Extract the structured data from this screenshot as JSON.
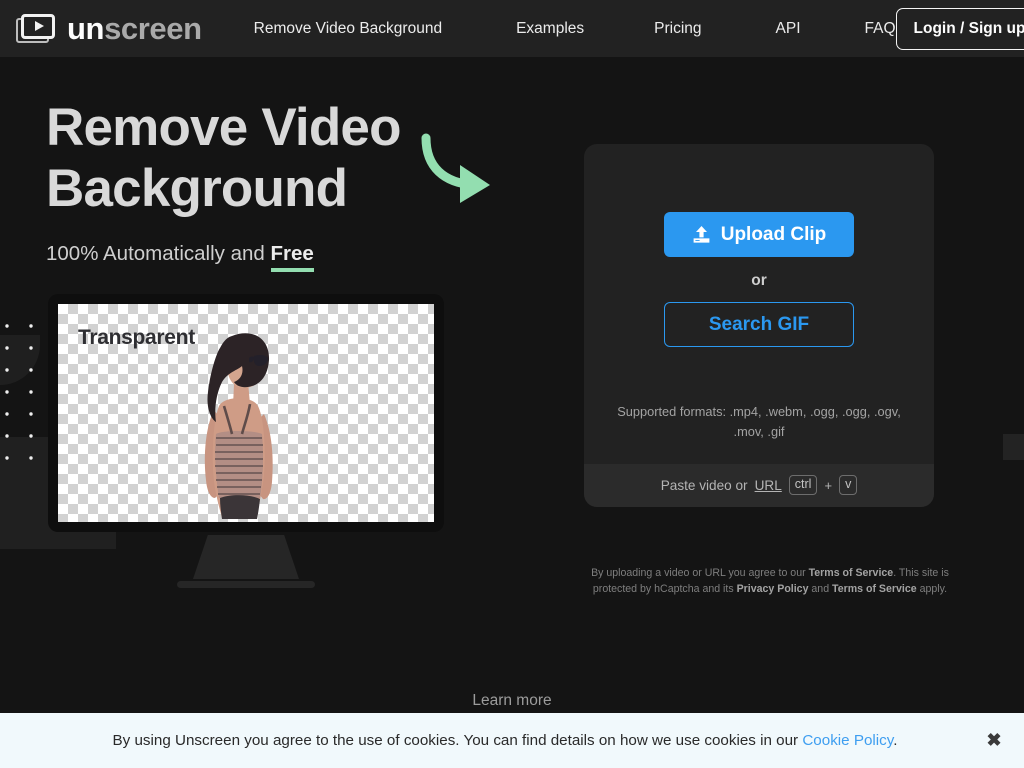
{
  "brand": {
    "logo_un": "un",
    "logo_screen": "screen",
    "logo_icon": "video-play-frame-icon",
    "name": "Unscreen"
  },
  "header": {
    "nav_items": [
      {
        "label": "Remove Video Background",
        "name": "nav-remove-video-background"
      },
      {
        "label": "Examples",
        "name": "nav-examples"
      },
      {
        "label": "Pricing",
        "name": "nav-pricing"
      },
      {
        "label": "API",
        "name": "nav-api"
      },
      {
        "label": "FAQ",
        "name": "nav-faq"
      }
    ],
    "login_label": "Login / Sign up"
  },
  "hero": {
    "title": "Remove Video Background",
    "subtitle_prefix": "100% Automatically and ",
    "subtitle_highlight": "Free",
    "arrow_icon": "curved-arrow-icon",
    "arrow_color": "#93deb0"
  },
  "preview": {
    "label": "Transparent",
    "figure_alt": "woman-back-view-striped-top",
    "checkerboard_light": "#ffffff",
    "checkerboard_dark": "#d2d2d2"
  },
  "upload": {
    "upload_label": "Upload Clip",
    "upload_icon": "upload-arrow-icon",
    "or_label": "or",
    "search_gif_label": "Search GIF",
    "supported_formats": "Supported formats: .mp4, .webm, .ogg, .ogg, .ogv, .mov, .gif",
    "paste_prefix": "Paste video or",
    "paste_link_label": "URL",
    "kbd_ctrl": "ctrl",
    "kbd_plus": "+",
    "kbd_v": "v",
    "accent_color": "#2b98f0"
  },
  "legal": {
    "part1": "By uploading a video or URL you agree to our ",
    "terms1": "Terms of Service",
    "part2": ". This site is protected by hCaptcha and its ",
    "privacy": "Privacy Policy",
    "part3": " and ",
    "terms2": "Terms of Service",
    "part4": " apply."
  },
  "footer": {
    "learn_more_label": "Learn more"
  },
  "cookie": {
    "message_before_link": "By using Unscreen you agree to the use of cookies. You can find details on how we use cookies in our ",
    "link_label": "Cookie Policy",
    "message_after_link": ".",
    "close_label": "✖",
    "link_color": "#3e9ef0",
    "background": "#f1f9fc"
  }
}
